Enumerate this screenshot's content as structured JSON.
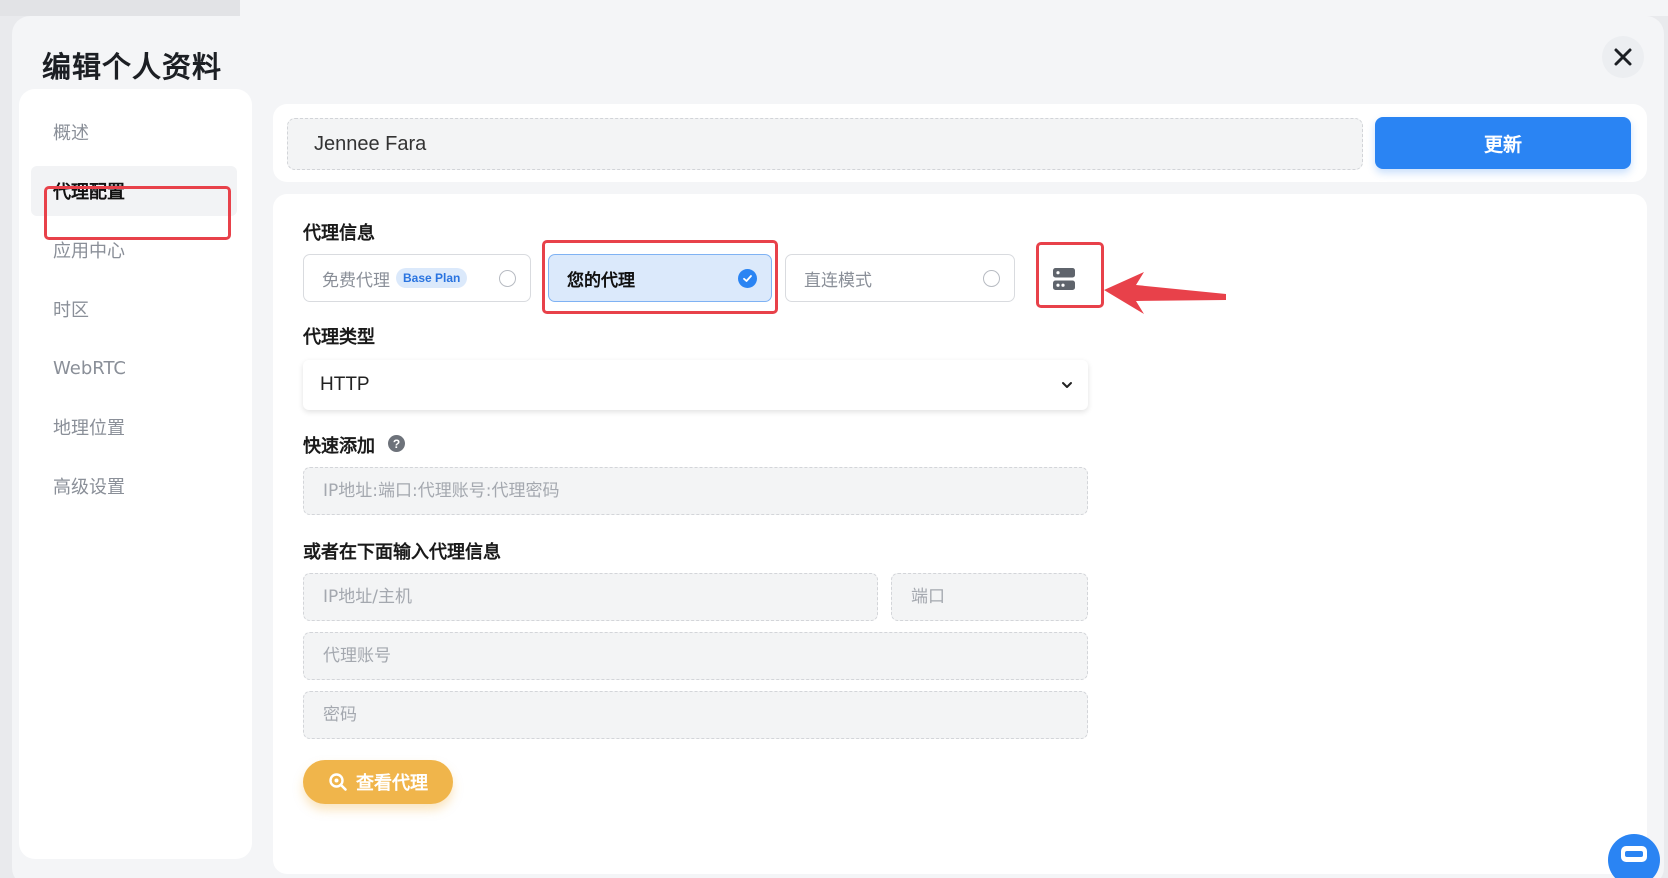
{
  "modal": {
    "title": "编辑个人资料"
  },
  "sidebar": {
    "items": [
      {
        "label": "概述",
        "active": false
      },
      {
        "label": "代理配置",
        "active": true
      },
      {
        "label": "应用中心",
        "active": false
      },
      {
        "label": "时区",
        "active": false
      },
      {
        "label": "WebRTC",
        "active": false
      },
      {
        "label": "地理位置",
        "active": false
      },
      {
        "label": "高级设置",
        "active": false
      }
    ]
  },
  "header": {
    "profile_name": "Jennee Fara",
    "update_label": "更新"
  },
  "proxy": {
    "info_label": "代理信息",
    "options": [
      {
        "label": "免费代理",
        "badge": "Base Plan",
        "selected": false
      },
      {
        "label": "您的代理",
        "selected": true
      },
      {
        "label": "直连模式",
        "selected": false
      }
    ],
    "type_label": "代理类型",
    "type_value": "HTTP",
    "quick_add_label": "快速添加",
    "quick_add_placeholder": "IP地址:端口:代理账号:代理密码",
    "manual_label": "或者在下面输入代理信息",
    "host_placeholder": "IP地址/主机",
    "port_placeholder": "端口",
    "account_placeholder": "代理账号",
    "password_placeholder": "密码",
    "view_label": "查看代理"
  },
  "colors": {
    "accent": "#2a84f3",
    "annotation": "#e8414a",
    "view_button": "#f0b54b"
  }
}
